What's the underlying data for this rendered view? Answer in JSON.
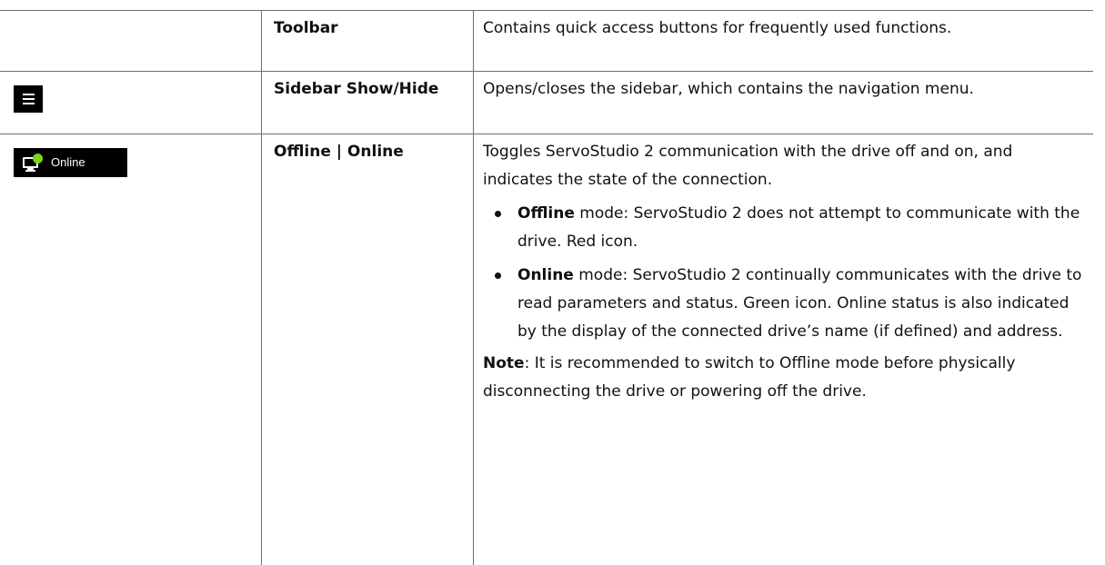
{
  "colors": {
    "icon_background": "#000000",
    "online_indicator": "#7ed321",
    "border": "#6f6f6f"
  },
  "rows": [
    {
      "icon": "",
      "term": "Toolbar",
      "description": "Contains quick access buttons for frequently used functions."
    },
    {
      "icon": "hamburger-menu-icon",
      "term": "Sidebar Show/Hide",
      "description": "Opens/closes the sidebar, which contains the navigation menu."
    },
    {
      "icon": "monitor-online-icon",
      "icon_label": "Online",
      "term": "Offline | Online",
      "description": "Toggles ServoStudio 2 communication with the drive off and on, and indicates the state of the connection.",
      "bullets": [
        {
          "bold": "Offline",
          "text": " mode: ServoStudio 2 does not attempt to communicate with the drive. Red icon."
        },
        {
          "bold": "Online",
          "text": " mode: ServoStudio 2 continually communicates with the drive to read parameters and status. Green icon. Online status is also indicated by the display of the connected drive’s name (if defined) and address."
        }
      ],
      "note_label": "Note",
      "note_text": ": It is recommended to switch to Offline mode before physically disconnecting the drive or powering off the drive."
    }
  ]
}
